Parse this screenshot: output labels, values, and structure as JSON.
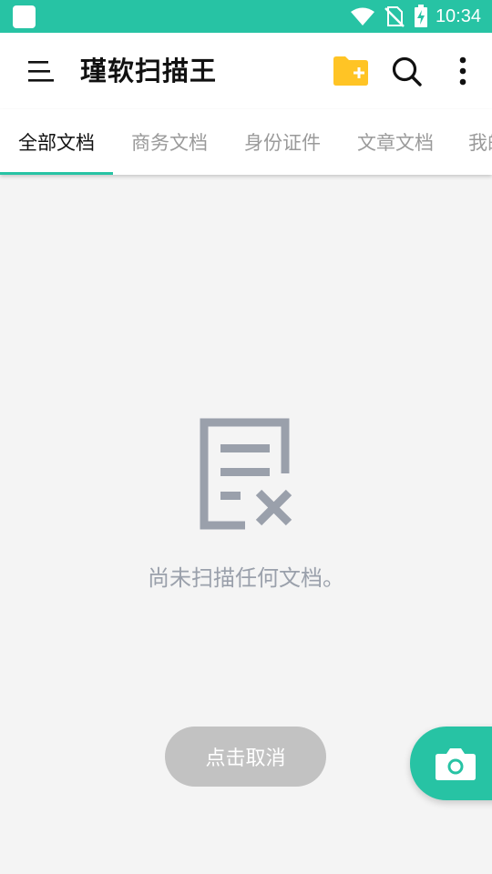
{
  "status_bar": {
    "time": "10:34",
    "icons": [
      "app-notification-icon",
      "wifi-icon",
      "no-sim-icon",
      "battery-charging-icon"
    ]
  },
  "app_bar": {
    "title": "瑾软扫描王",
    "icons": [
      "menu-icon",
      "new-folder-icon",
      "search-icon",
      "more-vert-icon"
    ]
  },
  "tabs": [
    {
      "label": "全部文档",
      "active": true
    },
    {
      "label": "商务文档",
      "active": false
    },
    {
      "label": "身份证件",
      "active": false
    },
    {
      "label": "文章文档",
      "active": false
    },
    {
      "label": "我的",
      "active": false
    }
  ],
  "empty_state": {
    "icon": "empty-document-icon",
    "message": "尚未扫描任何文档。"
  },
  "cancel_button": {
    "label": "点击取消"
  },
  "fab": {
    "icon": "camera-icon"
  },
  "colors": {
    "accent": "#27c3a4",
    "folder": "#ffc425",
    "empty_icon": "#9aa0ab",
    "cancel_bg": "#c2c2c2"
  }
}
